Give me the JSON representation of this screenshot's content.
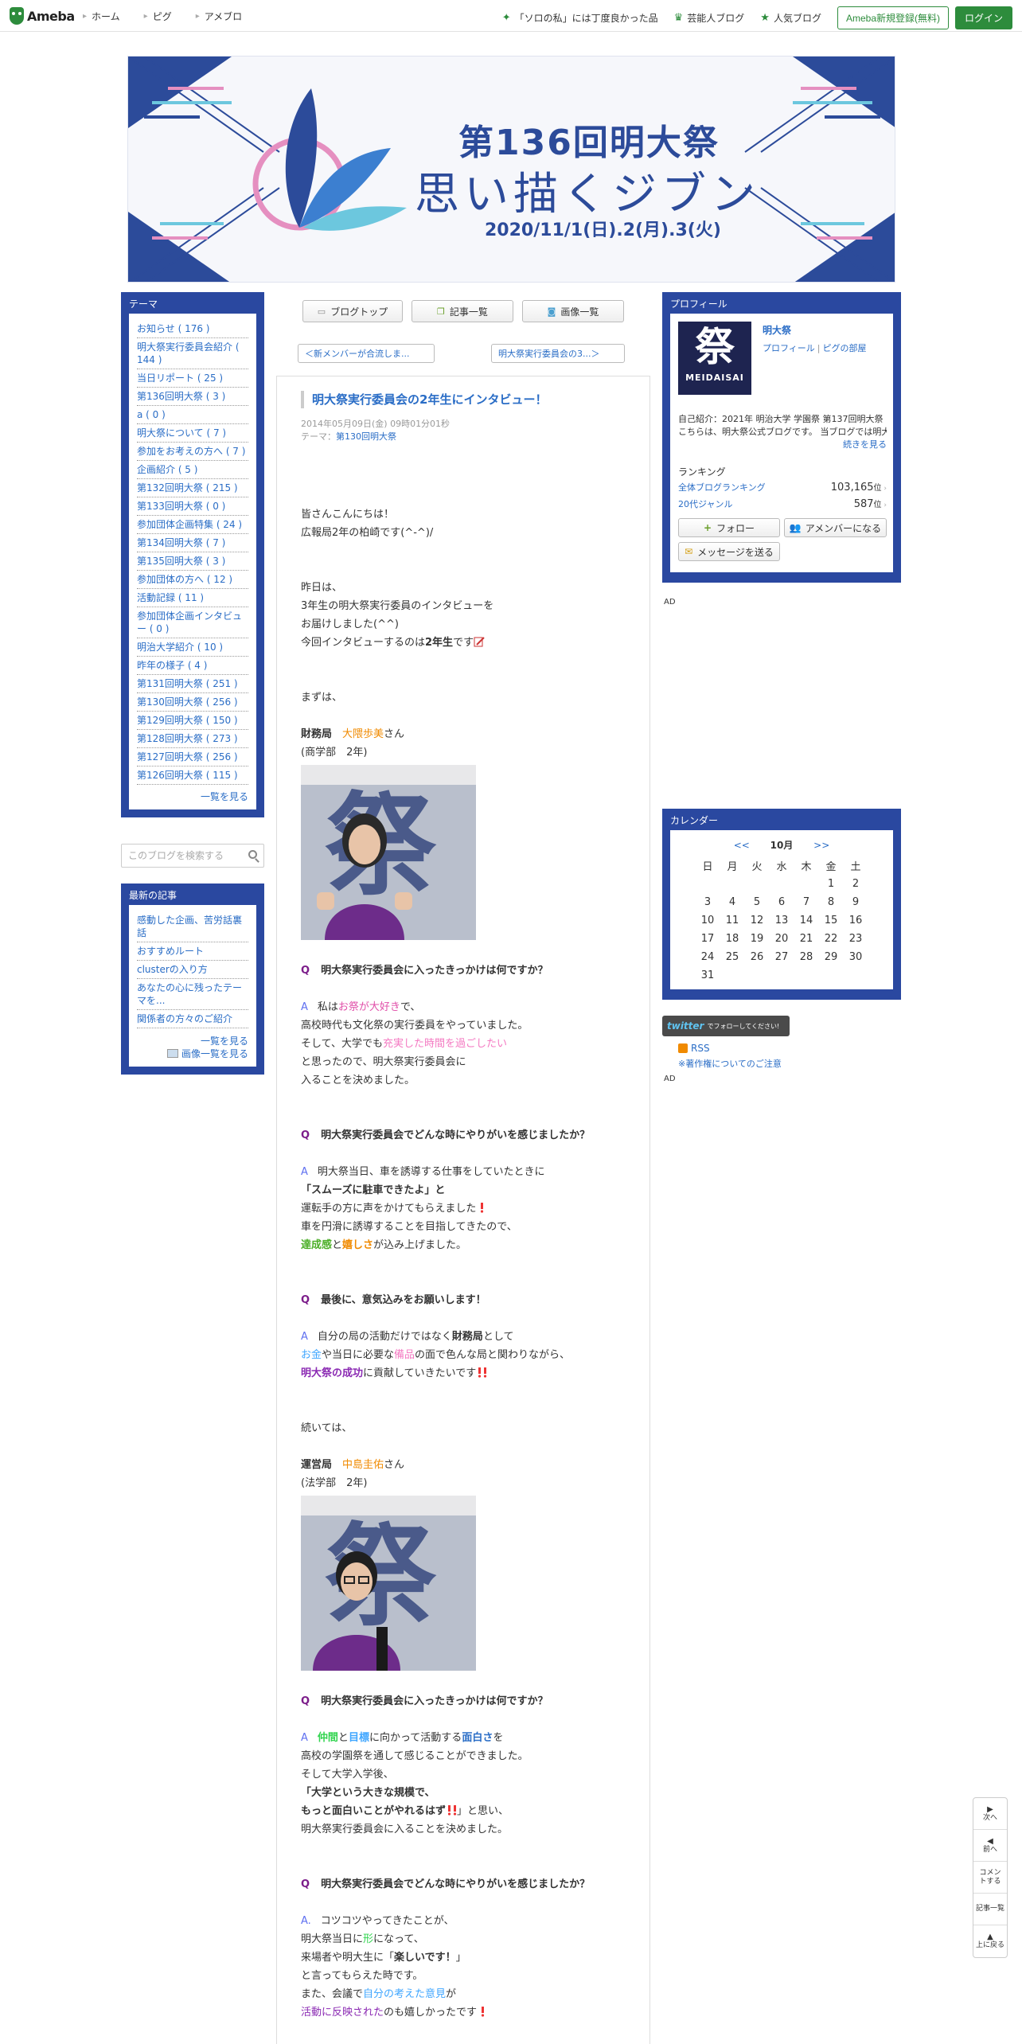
{
  "topbar": {
    "logo": "Ameba",
    "nav": [
      "ホーム",
      "ピグ",
      "アメブロ"
    ],
    "links": [
      {
        "icon": "sparkle-icon",
        "label": "「ソロの私」には丁度良かった品"
      },
      {
        "icon": "crown-icon",
        "label": "芸能人ブログ"
      },
      {
        "icon": "star-icon",
        "label": "人気ブログ"
      }
    ],
    "register": "Ameba新規登録(無料)",
    "login": "ログイン"
  },
  "banner": {
    "title": "第136回明大祭",
    "subtitle": "思い描くジブン",
    "date": "2020/11/1(日).2(月).3(火)"
  },
  "center_nav": {
    "blog_top": "ブログトップ",
    "article_list": "記事一覧",
    "image_list": "画像一覧",
    "prev": "＜新メンバーが合流しま...",
    "next": "明大祭実行委員会の3...＞"
  },
  "theme": {
    "header": "テーマ",
    "items": [
      "お知らせ ( 176 )",
      "明大祭実行委員会紹介 ( 144 )",
      "当日リポート ( 25 )",
      "第136回明大祭 ( 3 )",
      "a ( 0 )",
      "明大祭について ( 7 )",
      "参加をお考えの方へ ( 7 )",
      "企画紹介 ( 5 )",
      "第132回明大祭 ( 215 )",
      "第133回明大祭 ( 0 )",
      "参加団体企画特集 ( 24 )",
      "第134回明大祭 ( 7 )",
      "第135回明大祭 ( 3 )",
      "参加団体の方へ ( 12 )",
      "活動記録 ( 11 )",
      "参加団体企画インタビュー ( 0 )",
      "明治大学紹介 ( 10 )",
      "昨年の様子 ( 4 )",
      "第131回明大祭 ( 251 )",
      "第130回明大祭 ( 256 )",
      "第129回明大祭 ( 150 )",
      "第128回明大祭 ( 273 )",
      "第127回明大祭 ( 256 )",
      "第126回明大祭 ( 115 )"
    ],
    "more": "一覧を見る"
  },
  "search": {
    "placeholder": "このブログを検索する"
  },
  "recent": {
    "header": "最新の記事",
    "items": [
      "感動した企画、苦労話裏話",
      "おすすめルート",
      "clusterの入り方",
      "あなたの心に残ったテーマを...",
      "関係者の方々のご紹介"
    ],
    "more": "一覧を見る",
    "image_more": "画像一覧を見る"
  },
  "profile": {
    "header": "プロフィール",
    "name": "明大祭",
    "links": [
      "プロフィール",
      "ピグの部屋"
    ],
    "logo_kanji": "祭",
    "logo_text": "MEIDAISAI",
    "intro_line1": "自己紹介：2021年 明治大学 学園祭 第137回明大祭",
    "intro_line2": "こちらは、明大祭公式ブログです。 当ブログでは明大...",
    "intro_more": "続きを見る",
    "ranking_title": "ランキング",
    "ranking": [
      {
        "label": "全体ブログランキング",
        "value": "103,165",
        "unit": "位"
      },
      {
        "label": "20代ジャンル",
        "value": "587",
        "unit": "位"
      }
    ],
    "follow": "フォロー",
    "amember": "アメンバーになる",
    "message": "メッセージを送る",
    "ad": "AD"
  },
  "calendar": {
    "header": "カレンダー",
    "prev": "<<",
    "month": "10月",
    "next": ">>",
    "weekdays": [
      "日",
      "月",
      "火",
      "水",
      "木",
      "金",
      "土"
    ],
    "weeks": [
      [
        "",
        "",
        "",
        "",
        "",
        "1",
        "2"
      ],
      [
        "3",
        "4",
        "5",
        "6",
        "7",
        "8",
        "9"
      ],
      [
        "10",
        "11",
        "12",
        "13",
        "14",
        "15",
        "16"
      ],
      [
        "17",
        "18",
        "19",
        "20",
        "21",
        "22",
        "23"
      ],
      [
        "24",
        "25",
        "26",
        "27",
        "28",
        "29",
        "30"
      ],
      [
        "31",
        "",
        "",
        "",
        "",
        "",
        ""
      ]
    ]
  },
  "sidebar_extra": {
    "twitter": "twitter",
    "twitter_follow": "でフォローしてください!",
    "rss": "RSS",
    "copyright": "※著作権についてのご注意",
    "ad": "AD"
  },
  "article": {
    "title": "明大祭実行委員会の2年生にインタビュー！",
    "date": "2014年05月09日(金) 09時01分01秒",
    "theme_label": "テーマ：",
    "theme": "第130回明大祭",
    "intro1": "皆さんこんにちは！",
    "intro2": "広報局2年の柏崎です(^-^)/",
    "p2_1": "昨日は、",
    "p2_2": "3年生の明大祭実行委員のインタビューを",
    "p2_3": "お届けしました(^^)",
    "p2_4a": "今回インタビューするのは",
    "p2_4b": "2年生",
    "p2_4c": "です",
    "first": "まずは、",
    "m1_dept": "財務局",
    "m1_name": "大隈歩美",
    "m1_suffix": "さん",
    "m1_faculty": "(商学部　2年)",
    "q_mark": "Q",
    "a_mark": "A",
    "q1": "明大祭実行委員会に入ったきっかけは何ですか？",
    "a1_1a": "私は",
    "a1_1b": "お祭が大好き",
    "a1_1c": "で、",
    "a1_2": "高校時代も文化祭の実行委員をやっていました。",
    "a1_3a": "そして、大学でも",
    "a1_3b": "充実した時間を過ごしたい",
    "a1_4": "と思ったので、明大祭実行委員会に",
    "a1_5": "入ることを決めました。",
    "q2": "明大祭実行委員会でどんな時にやりがいを感じましたか？",
    "a2_1": "明大祭当日、車を誘導する仕事をしていたときに",
    "a2_2a": "「",
    "a2_2b": "スムーズに駐車できたよ",
    "a2_2c": "」と",
    "a2_3": "運転手の方に声をかけてもらえました",
    "a2_4": "車を円滑に誘導することを目指してきたので、",
    "a2_5a": "達成感",
    "a2_5b": "と",
    "a2_5c": "嬉しさ",
    "a2_5d": "が込み上げました。",
    "q3": "最後に、意気込みをお願いします！",
    "a3_1a": "自分の局の活動だけではなく",
    "a3_1b": "財務局",
    "a3_1c": "として",
    "a3_2a": "お金",
    "a3_2b": "や当日に必要な",
    "a3_2c": "備品",
    "a3_2d": "の面で色んな局と関わりながら、",
    "a3_3a": "明大祭の成功",
    "a3_3b": "に貢献していきたいです",
    "next_intro": "続いては、",
    "m2_dept": "運営局",
    "m2_name": "中島圭佑",
    "m2_suffix": "さん",
    "m2_faculty": "(法学部　2年)",
    "q4": "明大祭実行委員会に入ったきっかけは何ですか？",
    "a4_1a": "仲間",
    "a4_1b": "と",
    "a4_1c": "目標",
    "a4_1d": "に向かって活動する",
    "a4_1e": "面白さ",
    "a4_1f": "を",
    "a4_2": "高校の学園祭を通して感じることができました。",
    "a4_3": "そして大学入学後、",
    "a4_4": "「大学という大きな規模で、",
    "a4_5": "もっと面白いことがやれるはず",
    "a4_5b": "」と思い、",
    "a4_6": "明大祭実行委員会に入ることを決めました。",
    "q5": "明大祭実行委員会でどんな時にやりがいを感じましたか？",
    "a5_mark": "A.",
    "a5_1": "コツコツやってきたことが、",
    "a5_2a": "明大祭当日に",
    "a5_2b": "形",
    "a5_2c": "になって、",
    "a5_3a": "来場者や明大生に「",
    "a5_3b": "楽しいです！",
    "a5_3c": "」",
    "a5_4": "と言ってもらえた時です。",
    "a5_5a": "また、会議で",
    "a5_5b": "自分の考えた意見",
    "a5_5c": "が",
    "a5_6a": "活動に反映された",
    "a5_6b": "のも嬉しかったです"
  },
  "floatnav": {
    "next": "次へ",
    "prev": "前へ",
    "comment": "コメントする",
    "list": "記事一覧",
    "top": "上に戻る"
  },
  "colors": {
    "theme_blue": "#2a48a0",
    "ameba_green": "#2d8c3c",
    "link": "#2a6dc6"
  }
}
